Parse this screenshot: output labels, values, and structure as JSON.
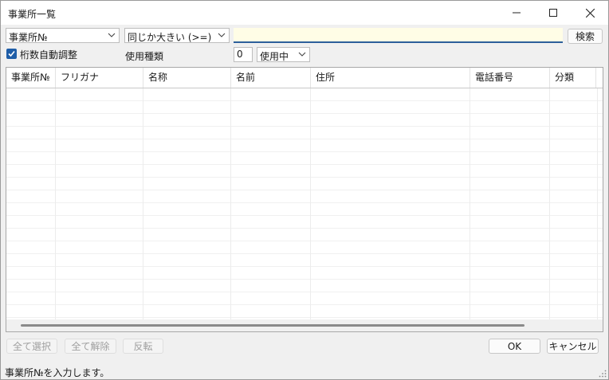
{
  "window": {
    "title": "事業所一覧"
  },
  "search": {
    "field_select": "事業所№",
    "condition_select": "同じか大きい (>=)",
    "text_value": "",
    "search_button": "検索"
  },
  "options": {
    "auto_digits_label": "桁数自動調整",
    "auto_digits_checked": true,
    "usage_type_label": "使用種類",
    "usage_type_code": "0",
    "usage_type_select": "使用中"
  },
  "grid": {
    "columns": [
      "事業所№",
      "フリガナ",
      "名称",
      "名前",
      "住所",
      "電話番号",
      "分類"
    ],
    "rows": []
  },
  "buttons": {
    "select_all": "全て選択",
    "deselect_all": "全て解除",
    "invert": "反転",
    "ok": "OK",
    "cancel": "キャンセル"
  },
  "status": {
    "message": "事業所№を入力します。"
  },
  "icons": {
    "minimize": "minimize-icon",
    "maximize": "maximize-icon",
    "close": "close-icon",
    "dropdown": "chevron-down-icon",
    "check": "check-icon",
    "grip": "resize-grip-icon"
  },
  "colors": {
    "accent": "#1f5ea8",
    "input_background": "#fffde6"
  }
}
